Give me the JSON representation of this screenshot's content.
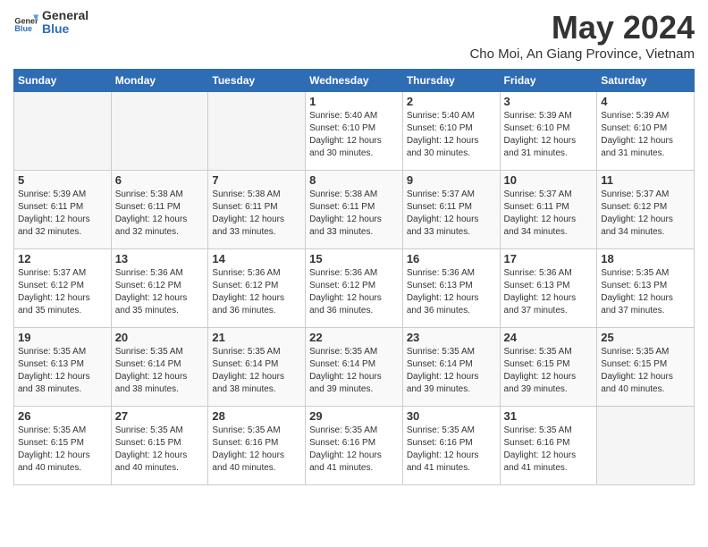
{
  "header": {
    "logo_line1": "General",
    "logo_line2": "Blue",
    "month_title": "May 2024",
    "location": "Cho Moi, An Giang Province, Vietnam"
  },
  "days_of_week": [
    "Sunday",
    "Monday",
    "Tuesday",
    "Wednesday",
    "Thursday",
    "Friday",
    "Saturday"
  ],
  "weeks": [
    [
      {
        "day": "",
        "empty": true
      },
      {
        "day": "",
        "empty": true
      },
      {
        "day": "",
        "empty": true
      },
      {
        "day": "1",
        "sunrise": "5:40 AM",
        "sunset": "6:10 PM",
        "daylight": "12 hours and 30 minutes."
      },
      {
        "day": "2",
        "sunrise": "5:40 AM",
        "sunset": "6:10 PM",
        "daylight": "12 hours and 30 minutes."
      },
      {
        "day": "3",
        "sunrise": "5:39 AM",
        "sunset": "6:10 PM",
        "daylight": "12 hours and 31 minutes."
      },
      {
        "day": "4",
        "sunrise": "5:39 AM",
        "sunset": "6:10 PM",
        "daylight": "12 hours and 31 minutes."
      }
    ],
    [
      {
        "day": "5",
        "sunrise": "5:39 AM",
        "sunset": "6:11 PM",
        "daylight": "12 hours and 32 minutes."
      },
      {
        "day": "6",
        "sunrise": "5:38 AM",
        "sunset": "6:11 PM",
        "daylight": "12 hours and 32 minutes."
      },
      {
        "day": "7",
        "sunrise": "5:38 AM",
        "sunset": "6:11 PM",
        "daylight": "12 hours and 33 minutes."
      },
      {
        "day": "8",
        "sunrise": "5:38 AM",
        "sunset": "6:11 PM",
        "daylight": "12 hours and 33 minutes."
      },
      {
        "day": "9",
        "sunrise": "5:37 AM",
        "sunset": "6:11 PM",
        "daylight": "12 hours and 33 minutes."
      },
      {
        "day": "10",
        "sunrise": "5:37 AM",
        "sunset": "6:11 PM",
        "daylight": "12 hours and 34 minutes."
      },
      {
        "day": "11",
        "sunrise": "5:37 AM",
        "sunset": "6:12 PM",
        "daylight": "12 hours and 34 minutes."
      }
    ],
    [
      {
        "day": "12",
        "sunrise": "5:37 AM",
        "sunset": "6:12 PM",
        "daylight": "12 hours and 35 minutes."
      },
      {
        "day": "13",
        "sunrise": "5:36 AM",
        "sunset": "6:12 PM",
        "daylight": "12 hours and 35 minutes."
      },
      {
        "day": "14",
        "sunrise": "5:36 AM",
        "sunset": "6:12 PM",
        "daylight": "12 hours and 36 minutes."
      },
      {
        "day": "15",
        "sunrise": "5:36 AM",
        "sunset": "6:12 PM",
        "daylight": "12 hours and 36 minutes."
      },
      {
        "day": "16",
        "sunrise": "5:36 AM",
        "sunset": "6:13 PM",
        "daylight": "12 hours and 36 minutes."
      },
      {
        "day": "17",
        "sunrise": "5:36 AM",
        "sunset": "6:13 PM",
        "daylight": "12 hours and 37 minutes."
      },
      {
        "day": "18",
        "sunrise": "5:35 AM",
        "sunset": "6:13 PM",
        "daylight": "12 hours and 37 minutes."
      }
    ],
    [
      {
        "day": "19",
        "sunrise": "5:35 AM",
        "sunset": "6:13 PM",
        "daylight": "12 hours and 38 minutes."
      },
      {
        "day": "20",
        "sunrise": "5:35 AM",
        "sunset": "6:14 PM",
        "daylight": "12 hours and 38 minutes."
      },
      {
        "day": "21",
        "sunrise": "5:35 AM",
        "sunset": "6:14 PM",
        "daylight": "12 hours and 38 minutes."
      },
      {
        "day": "22",
        "sunrise": "5:35 AM",
        "sunset": "6:14 PM",
        "daylight": "12 hours and 39 minutes."
      },
      {
        "day": "23",
        "sunrise": "5:35 AM",
        "sunset": "6:14 PM",
        "daylight": "12 hours and 39 minutes."
      },
      {
        "day": "24",
        "sunrise": "5:35 AM",
        "sunset": "6:15 PM",
        "daylight": "12 hours and 39 minutes."
      },
      {
        "day": "25",
        "sunrise": "5:35 AM",
        "sunset": "6:15 PM",
        "daylight": "12 hours and 40 minutes."
      }
    ],
    [
      {
        "day": "26",
        "sunrise": "5:35 AM",
        "sunset": "6:15 PM",
        "daylight": "12 hours and 40 minutes."
      },
      {
        "day": "27",
        "sunrise": "5:35 AM",
        "sunset": "6:15 PM",
        "daylight": "12 hours and 40 minutes."
      },
      {
        "day": "28",
        "sunrise": "5:35 AM",
        "sunset": "6:16 PM",
        "daylight": "12 hours and 40 minutes."
      },
      {
        "day": "29",
        "sunrise": "5:35 AM",
        "sunset": "6:16 PM",
        "daylight": "12 hours and 41 minutes."
      },
      {
        "day": "30",
        "sunrise": "5:35 AM",
        "sunset": "6:16 PM",
        "daylight": "12 hours and 41 minutes."
      },
      {
        "day": "31",
        "sunrise": "5:35 AM",
        "sunset": "6:16 PM",
        "daylight": "12 hours and 41 minutes."
      },
      {
        "day": "",
        "empty": true
      }
    ]
  ]
}
